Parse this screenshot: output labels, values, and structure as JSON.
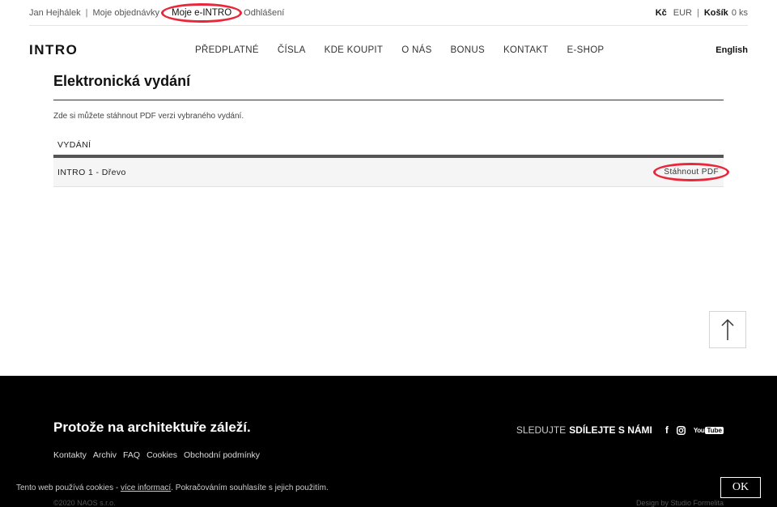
{
  "topbar": {
    "user": "Jan Hejhálek",
    "separator": "|",
    "orders": "Moje objednávky",
    "my_intro": "Moje e-INTRO",
    "logout": "Odhlášení",
    "currency_czk": "Kč",
    "currency_eur": "EUR",
    "cart_label": "Košík",
    "cart_count": "0 ks"
  },
  "header": {
    "logo": "INTRO",
    "nav": [
      "PŘEDPLATNÉ",
      "ČÍSLA",
      "KDE KOUPIT",
      "O NÁS",
      "BONUS",
      "KONTAKT",
      "E-SHOP"
    ],
    "language": "English"
  },
  "main": {
    "title": "Elektronická vydání",
    "intro": "Zde si můžete stáhnout PDF verzi vybraného vydání.",
    "table_header": "VYDÁNÍ",
    "rows": [
      {
        "issue": "INTRO 1 - Dřevo",
        "download": "Stáhnout PDF"
      }
    ]
  },
  "footer": {
    "slogan": "Protože na architektuře záleží.",
    "links": [
      "Kontakty",
      "Archiv",
      "FAQ",
      "Cookies",
      "Obchodní podmínky"
    ],
    "follow_light": "SLEDUJTE",
    "follow_strong": "SDÍLEJTE S NÁMI",
    "social_icons": [
      "facebook-icon",
      "instagram-icon",
      "youtube-icon"
    ],
    "youtube_text": "YouTube",
    "copyright": "©2020 NAOS s.r.o.",
    "design": "Design by Studio Formelita"
  },
  "cookie": {
    "text_before": "Tento web používá cookies - ",
    "link": "více informací",
    "text_after": ". Pokračováním souhlasíte s jejich použitím.",
    "ok": "OK"
  },
  "colors": {
    "highlight": "#e8283a",
    "footer_bg": "#000000"
  }
}
